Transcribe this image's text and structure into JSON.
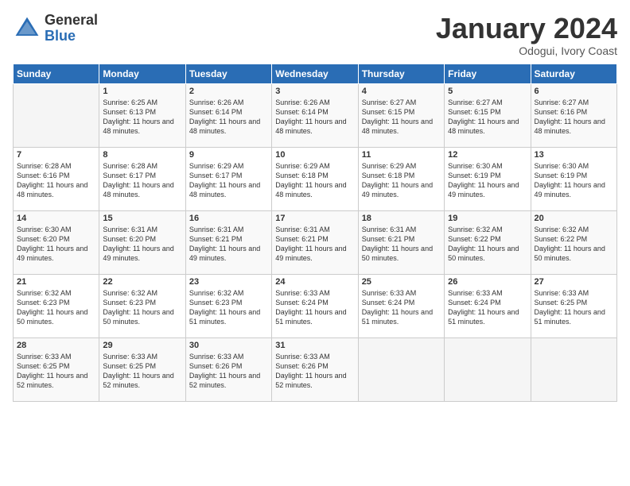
{
  "header": {
    "logo_general": "General",
    "logo_blue": "Blue",
    "month": "January 2024",
    "location": "Odogui, Ivory Coast"
  },
  "days_of_week": [
    "Sunday",
    "Monday",
    "Tuesday",
    "Wednesday",
    "Thursday",
    "Friday",
    "Saturday"
  ],
  "weeks": [
    [
      {
        "day": "",
        "empty": true
      },
      {
        "day": "1",
        "sunrise": "Sunrise: 6:25 AM",
        "sunset": "Sunset: 6:13 PM",
        "daylight": "Daylight: 11 hours and 48 minutes."
      },
      {
        "day": "2",
        "sunrise": "Sunrise: 6:26 AM",
        "sunset": "Sunset: 6:14 PM",
        "daylight": "Daylight: 11 hours and 48 minutes."
      },
      {
        "day": "3",
        "sunrise": "Sunrise: 6:26 AM",
        "sunset": "Sunset: 6:14 PM",
        "daylight": "Daylight: 11 hours and 48 minutes."
      },
      {
        "day": "4",
        "sunrise": "Sunrise: 6:27 AM",
        "sunset": "Sunset: 6:15 PM",
        "daylight": "Daylight: 11 hours and 48 minutes."
      },
      {
        "day": "5",
        "sunrise": "Sunrise: 6:27 AM",
        "sunset": "Sunset: 6:15 PM",
        "daylight": "Daylight: 11 hours and 48 minutes."
      },
      {
        "day": "6",
        "sunrise": "Sunrise: 6:27 AM",
        "sunset": "Sunset: 6:16 PM",
        "daylight": "Daylight: 11 hours and 48 minutes."
      }
    ],
    [
      {
        "day": "7",
        "sunrise": "Sunrise: 6:28 AM",
        "sunset": "Sunset: 6:16 PM",
        "daylight": "Daylight: 11 hours and 48 minutes."
      },
      {
        "day": "8",
        "sunrise": "Sunrise: 6:28 AM",
        "sunset": "Sunset: 6:17 PM",
        "daylight": "Daylight: 11 hours and 48 minutes."
      },
      {
        "day": "9",
        "sunrise": "Sunrise: 6:29 AM",
        "sunset": "Sunset: 6:17 PM",
        "daylight": "Daylight: 11 hours and 48 minutes."
      },
      {
        "day": "10",
        "sunrise": "Sunrise: 6:29 AM",
        "sunset": "Sunset: 6:18 PM",
        "daylight": "Daylight: 11 hours and 48 minutes."
      },
      {
        "day": "11",
        "sunrise": "Sunrise: 6:29 AM",
        "sunset": "Sunset: 6:18 PM",
        "daylight": "Daylight: 11 hours and 49 minutes."
      },
      {
        "day": "12",
        "sunrise": "Sunrise: 6:30 AM",
        "sunset": "Sunset: 6:19 PM",
        "daylight": "Daylight: 11 hours and 49 minutes."
      },
      {
        "day": "13",
        "sunrise": "Sunrise: 6:30 AM",
        "sunset": "Sunset: 6:19 PM",
        "daylight": "Daylight: 11 hours and 49 minutes."
      }
    ],
    [
      {
        "day": "14",
        "sunrise": "Sunrise: 6:30 AM",
        "sunset": "Sunset: 6:20 PM",
        "daylight": "Daylight: 11 hours and 49 minutes."
      },
      {
        "day": "15",
        "sunrise": "Sunrise: 6:31 AM",
        "sunset": "Sunset: 6:20 PM",
        "daylight": "Daylight: 11 hours and 49 minutes."
      },
      {
        "day": "16",
        "sunrise": "Sunrise: 6:31 AM",
        "sunset": "Sunset: 6:21 PM",
        "daylight": "Daylight: 11 hours and 49 minutes."
      },
      {
        "day": "17",
        "sunrise": "Sunrise: 6:31 AM",
        "sunset": "Sunset: 6:21 PM",
        "daylight": "Daylight: 11 hours and 49 minutes."
      },
      {
        "day": "18",
        "sunrise": "Sunrise: 6:31 AM",
        "sunset": "Sunset: 6:21 PM",
        "daylight": "Daylight: 11 hours and 50 minutes."
      },
      {
        "day": "19",
        "sunrise": "Sunrise: 6:32 AM",
        "sunset": "Sunset: 6:22 PM",
        "daylight": "Daylight: 11 hours and 50 minutes."
      },
      {
        "day": "20",
        "sunrise": "Sunrise: 6:32 AM",
        "sunset": "Sunset: 6:22 PM",
        "daylight": "Daylight: 11 hours and 50 minutes."
      }
    ],
    [
      {
        "day": "21",
        "sunrise": "Sunrise: 6:32 AM",
        "sunset": "Sunset: 6:23 PM",
        "daylight": "Daylight: 11 hours and 50 minutes."
      },
      {
        "day": "22",
        "sunrise": "Sunrise: 6:32 AM",
        "sunset": "Sunset: 6:23 PM",
        "daylight": "Daylight: 11 hours and 50 minutes."
      },
      {
        "day": "23",
        "sunrise": "Sunrise: 6:32 AM",
        "sunset": "Sunset: 6:23 PM",
        "daylight": "Daylight: 11 hours and 51 minutes."
      },
      {
        "day": "24",
        "sunrise": "Sunrise: 6:33 AM",
        "sunset": "Sunset: 6:24 PM",
        "daylight": "Daylight: 11 hours and 51 minutes."
      },
      {
        "day": "25",
        "sunrise": "Sunrise: 6:33 AM",
        "sunset": "Sunset: 6:24 PM",
        "daylight": "Daylight: 11 hours and 51 minutes."
      },
      {
        "day": "26",
        "sunrise": "Sunrise: 6:33 AM",
        "sunset": "Sunset: 6:24 PM",
        "daylight": "Daylight: 11 hours and 51 minutes."
      },
      {
        "day": "27",
        "sunrise": "Sunrise: 6:33 AM",
        "sunset": "Sunset: 6:25 PM",
        "daylight": "Daylight: 11 hours and 51 minutes."
      }
    ],
    [
      {
        "day": "28",
        "sunrise": "Sunrise: 6:33 AM",
        "sunset": "Sunset: 6:25 PM",
        "daylight": "Daylight: 11 hours and 52 minutes."
      },
      {
        "day": "29",
        "sunrise": "Sunrise: 6:33 AM",
        "sunset": "Sunset: 6:25 PM",
        "daylight": "Daylight: 11 hours and 52 minutes."
      },
      {
        "day": "30",
        "sunrise": "Sunrise: 6:33 AM",
        "sunset": "Sunset: 6:26 PM",
        "daylight": "Daylight: 11 hours and 52 minutes."
      },
      {
        "day": "31",
        "sunrise": "Sunrise: 6:33 AM",
        "sunset": "Sunset: 6:26 PM",
        "daylight": "Daylight: 11 hours and 52 minutes."
      },
      {
        "day": "",
        "empty": true
      },
      {
        "day": "",
        "empty": true
      },
      {
        "day": "",
        "empty": true
      }
    ]
  ]
}
